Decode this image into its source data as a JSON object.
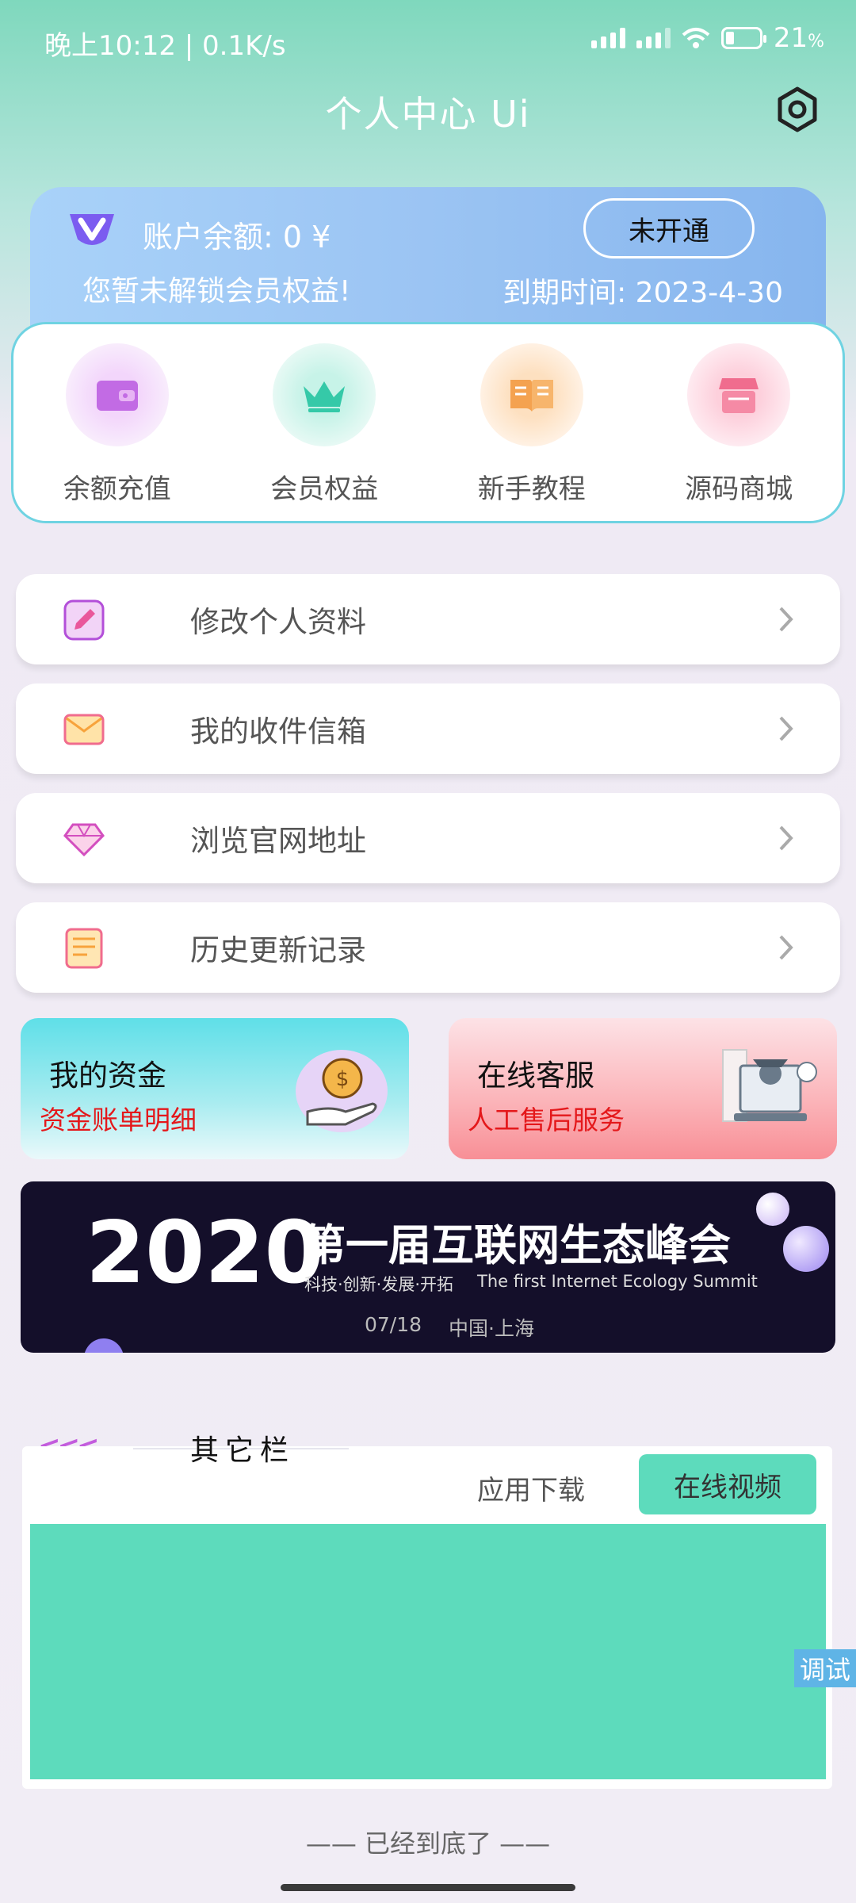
{
  "status": {
    "time": "晚上10:12 | 0.1K/s",
    "battery": "21",
    "battery_unit": "%"
  },
  "header": {
    "title": "个人中心 Ui",
    "settings_icon": "gear-icon"
  },
  "account": {
    "balance": "账户余额: 0 ¥",
    "unlock_text": "您暂未解锁会员权益!",
    "expire_text": "到期时间: 2023-4-30",
    "open_button": "未开通",
    "vip_icon": "vip-badge-icon"
  },
  "quick": [
    {
      "label": "余额充值",
      "icon": "wallet-icon",
      "color": "#c16be0"
    },
    {
      "label": "会员权益",
      "icon": "crown-icon",
      "color": "#35c9a8"
    },
    {
      "label": "新手教程",
      "icon": "book-icon",
      "color": "#f4a250"
    },
    {
      "label": "源码商城",
      "icon": "store-icon",
      "color": "#f06c8e"
    }
  ],
  "menu": [
    {
      "label": "修改个人资料",
      "icon": "edit-icon"
    },
    {
      "label": "我的收件信箱",
      "icon": "mail-icon"
    },
    {
      "label": "浏览官网地址",
      "icon": "diamond-icon"
    },
    {
      "label": "历史更新记录",
      "icon": "document-icon"
    }
  ],
  "cards": {
    "funds": {
      "title": "我的资金",
      "subtitle": "资金账单明细"
    },
    "service": {
      "title": "在线客服",
      "subtitle": "人工售后服务"
    }
  },
  "banner": {
    "year": "2020",
    "headline": "第一届互联网生态峰会",
    "tagline": "科技·创新·发展·开拓",
    "english": "The first Internet Ecology Summit",
    "date": "07/18",
    "location": "中国·上海"
  },
  "other": {
    "title": "其它栏",
    "arrows": "<<<",
    "tab_app": "应用下载",
    "tab_video": "在线视频"
  },
  "debug_label": "调试",
  "footer": "—— 已经到底了 ——"
}
